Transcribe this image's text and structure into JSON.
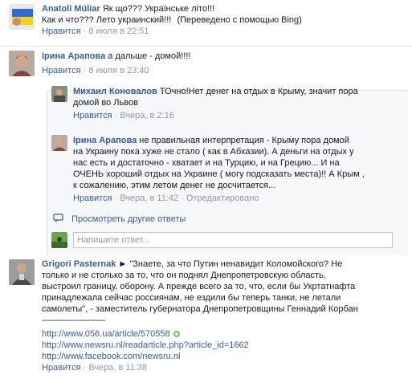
{
  "comments": [
    {
      "author": "Anatoli Múliar",
      "text": "Як що??? Українське літо!!!",
      "translation": "Как и что??? Лето украинский!!!",
      "translation_note": "(Переведено с помощью Bing)",
      "like": "Нравится",
      "time": "8 июля в 22:51"
    },
    {
      "author": "Ірина Арапова",
      "text": "а дальше - домой!!!!",
      "like": "Нравится",
      "time": "8 июля в 23:40"
    }
  ],
  "replies": [
    {
      "author": "Михаил Коновалов",
      "text_line1": "ТОчно!Нет денег на отдых в Крыму, значит пора",
      "text_line2": "домой во Львов",
      "like": "Нравится",
      "time": "Вчера, в 2:16"
    },
    {
      "author": "Ірина Арапова",
      "text_line1": "не правильная интерпретация - Крыму пора домой",
      "text_line2": "на Украину пока хуже не стало ( как в Абхазии). А деньги на отдых у",
      "text_line3": "нас есть и достаточно - хватает и на Турцию, и на Грецию... И на",
      "text_line4": "ОЧЕНЬ хороший отдых на Украине ( могу подсказать места)!! А Крым ,",
      "text_line5": "к сожалению, этим летом денег не досчитается...",
      "like": "Нравится",
      "time": "Вчера, в 11:42",
      "edited": "Отредактировано"
    }
  ],
  "more_replies": "Просмотреть другие ответы",
  "reply_input": {
    "placeholder": "Напишите ответ..."
  },
  "post3": {
    "author": "Grigori Pasternak",
    "arrow": "►",
    "line1": "\"Знаете, за что Путин ненавидит Коломойского? Не",
    "line2": "только и не столько за то, что он поднял Днепропетровскую область,",
    "line3": "выстроил границу, оборону. А прежде всего за то, что, если бы Укртатнафта",
    "line4": "принадлежала сейчас россиянам, не ездили бы теперь танки, не летали",
    "line5": "самолеты\", - заместитель губернатора Днепропетровщины Геннадий Корбан",
    "line6": "-------------------------",
    "links": [
      "http://www.056.ua/article/570558",
      "http://www.newsru.nl/readarticle.php?article_id=1662",
      "http://www.facebook.com/newsru.nl"
    ],
    "like": "Нравится",
    "time": "Вчера, в 11:38"
  },
  "separator": "·",
  "colors": {
    "link": "#3b5998",
    "meta": "#9197a3",
    "panel": "#f6f7f9"
  }
}
